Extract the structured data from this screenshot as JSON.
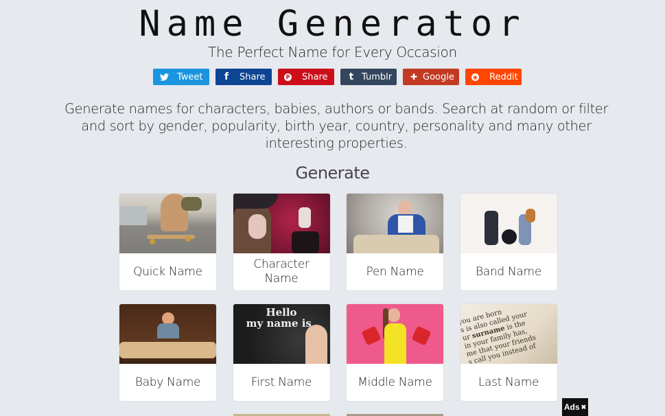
{
  "header": {
    "title": "Name Generator",
    "subtitle": "The Perfect Name for Every Occasion"
  },
  "share_buttons": [
    {
      "label": "Tweet",
      "icon": "twitter-icon",
      "glyph": "🐦",
      "color": "#1b95e0"
    },
    {
      "label": "Share",
      "icon": "facebook-icon",
      "glyph": "f",
      "color": "#0d4493"
    },
    {
      "label": "Share",
      "icon": "pinterest-icon",
      "glyph": "P",
      "color": "#cb0e19"
    },
    {
      "label": "Tumblr",
      "icon": "tumblr-icon",
      "glyph": "t",
      "color": "#34465d"
    },
    {
      "label": "Google",
      "icon": "google-plus-icon",
      "glyph": "✚",
      "color": "#c23a22"
    },
    {
      "label": "Reddit",
      "icon": "reddit-icon",
      "glyph": "●",
      "color": "#ff4500"
    }
  ],
  "description": "Generate names for characters, babies, authors or bands. Search at random or filter and sort by gender, popularity, birth year, country, personality and many other interesting properties.",
  "generate": {
    "title": "Generate",
    "cards": [
      {
        "label": "Quick Name",
        "image": "skateboarder-photo"
      },
      {
        "label": "Character Name",
        "image": "costumed-character-photo"
      },
      {
        "label": "Pen Name",
        "image": "writer-with-books-photo"
      },
      {
        "label": "Band Name",
        "image": "rock-band-photo"
      },
      {
        "label": "Baby Name",
        "image": "baby-with-books-photo"
      },
      {
        "label": "First Name",
        "image": "hello-my-name-is-photo"
      },
      {
        "label": "Middle Name",
        "image": "woman-with-shoes-photo"
      },
      {
        "label": "Last Name",
        "image": "dictionary-surname-photo"
      }
    ]
  },
  "ads_badge": {
    "label": "Ads",
    "close_glyph": "✖"
  }
}
